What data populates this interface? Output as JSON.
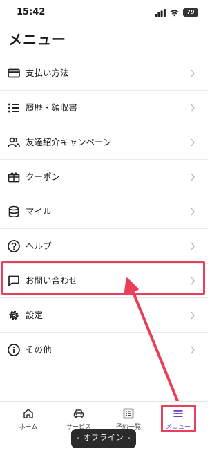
{
  "status_bar": {
    "time": "15:42",
    "battery": "79"
  },
  "page_title": "メニュー",
  "menu_items": [
    {
      "label": "支払い方法",
      "icon": "credit-card-icon"
    },
    {
      "label": "履歴・領収書",
      "icon": "list-icon"
    },
    {
      "label": "友達紹介キャンペーン",
      "icon": "users-icon"
    },
    {
      "label": "クーポン",
      "icon": "gift-icon"
    },
    {
      "label": "マイル",
      "icon": "database-icon"
    },
    {
      "label": "ヘルプ",
      "icon": "help-circle-icon"
    },
    {
      "label": "お問い合わせ",
      "icon": "message-square-icon"
    },
    {
      "label": "設定",
      "icon": "gear-icon"
    },
    {
      "label": "その他",
      "icon": "info-circle-icon"
    }
  ],
  "tab_bar": [
    {
      "label": "ホーム",
      "icon": "home-icon"
    },
    {
      "label": "サービス",
      "icon": "car-icon"
    },
    {
      "label": "予約一覧",
      "icon": "reservation-list-icon"
    },
    {
      "label": "メニュー",
      "icon": "hamburger-menu-icon",
      "active": true
    }
  ],
  "offline_banner": "- オフライン -",
  "colors": {
    "accent": "#6b3fd6",
    "annotation": "#e8405a",
    "text": "#1a1a1a"
  }
}
